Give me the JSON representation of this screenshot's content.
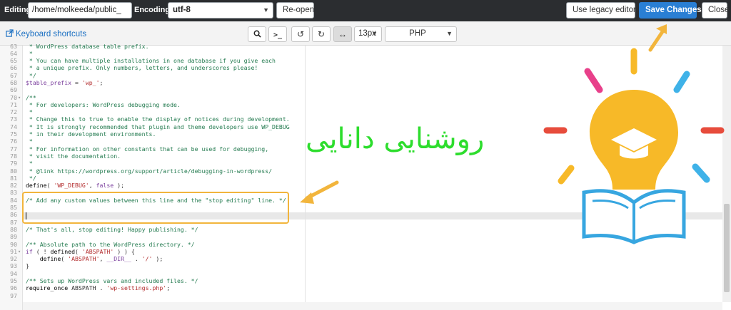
{
  "topbar": {
    "editing_label": "Editing:",
    "path_value": "/home/molkeeda/public_",
    "encoding_label": "Encoding:",
    "encoding_value": "utf-8",
    "reopen_label": "Re-open",
    "legacy_label": "Use legacy editor",
    "save_label": "Save Changes",
    "close_label": "Close"
  },
  "toolbar": {
    "shortcuts_label": "Keyboard shortcuts",
    "font_size": "13px",
    "mode": "PHP",
    "icons": [
      "search-icon",
      "terminal-icon",
      "undo-icon",
      "redo-icon",
      "wrap-icon"
    ]
  },
  "code": {
    "lines": [
      {
        "n": "63",
        "t": " * WordPress database table prefix.",
        "c": "comment",
        "fold": ""
      },
      {
        "n": "64",
        "t": " *",
        "c": "comment",
        "fold": ""
      },
      {
        "n": "65",
        "t": " * You can have multiple installations in one database if you give each",
        "c": "comment",
        "fold": ""
      },
      {
        "n": "66",
        "t": " * a unique prefix. Only numbers, letters, and underscores please!",
        "c": "comment",
        "fold": ""
      },
      {
        "n": "67",
        "t": " */",
        "c": "comment",
        "fold": ""
      },
      {
        "n": "68",
        "t": "",
        "c": "tableprefix",
        "fold": ""
      },
      {
        "n": "69",
        "t": "",
        "c": "plain",
        "fold": ""
      },
      {
        "n": "70",
        "t": "/**",
        "c": "comment",
        "fold": "▾"
      },
      {
        "n": "71",
        "t": " * For developers: WordPress debugging mode.",
        "c": "comment",
        "fold": ""
      },
      {
        "n": "72",
        "t": " *",
        "c": "comment",
        "fold": ""
      },
      {
        "n": "73",
        "t": " * Change this to true to enable the display of notices during development.",
        "c": "comment",
        "fold": ""
      },
      {
        "n": "74",
        "t": " * It is strongly recommended that plugin and theme developers use WP_DEBUG",
        "c": "comment",
        "fold": ""
      },
      {
        "n": "75",
        "t": " * in their development environments.",
        "c": "comment",
        "fold": ""
      },
      {
        "n": "76",
        "t": " *",
        "c": "comment",
        "fold": ""
      },
      {
        "n": "77",
        "t": " * For information on other constants that can be used for debugging,",
        "c": "comment",
        "fold": ""
      },
      {
        "n": "78",
        "t": " * visit the documentation.",
        "c": "comment",
        "fold": ""
      },
      {
        "n": "79",
        "t": " *",
        "c": "comment",
        "fold": ""
      },
      {
        "n": "80",
        "t": " * @link https://wordpress.org/support/article/debugging-in-wordpress/",
        "c": "comment",
        "fold": ""
      },
      {
        "n": "81",
        "t": " */",
        "c": "comment",
        "fold": ""
      },
      {
        "n": "82",
        "t": "",
        "c": "wpdebug",
        "fold": ""
      },
      {
        "n": "83",
        "t": "",
        "c": "plain",
        "fold": ""
      },
      {
        "n": "84",
        "t": "/* Add any custom values between this line and the \"stop editing\" line. */",
        "c": "comment",
        "fold": ""
      },
      {
        "n": "85",
        "t": "",
        "c": "plain",
        "fold": ""
      },
      {
        "n": "86",
        "t": "",
        "c": "plain",
        "fold": "",
        "active": true
      },
      {
        "n": "87",
        "t": "",
        "c": "plain",
        "fold": ""
      },
      {
        "n": "88",
        "t": "/* That's all, stop editing! Happy publishing. */",
        "c": "comment",
        "fold": ""
      },
      {
        "n": "89",
        "t": "",
        "c": "plain",
        "fold": ""
      },
      {
        "n": "90",
        "t": "/** Absolute path to the WordPress directory. */",
        "c": "comment",
        "fold": ""
      },
      {
        "n": "91",
        "t": "",
        "c": "ifabspath",
        "fold": "▾"
      },
      {
        "n": "92",
        "t": "",
        "c": "defineabspath",
        "fold": ""
      },
      {
        "n": "93",
        "t": "}",
        "c": "plain",
        "fold": ""
      },
      {
        "n": "94",
        "t": "",
        "c": "plain",
        "fold": ""
      },
      {
        "n": "95",
        "t": "/** Sets up WordPress vars and included files. */",
        "c": "comment",
        "fold": ""
      },
      {
        "n": "96",
        "t": "",
        "c": "require",
        "fold": ""
      },
      {
        "n": "97",
        "t": "",
        "c": "plain",
        "fold": ""
      }
    ]
  },
  "overlay": {
    "persian_text": "روشنایی دانایی",
    "colors": {
      "accent": "#f2b53c",
      "green": "#2ddd2d",
      "bulb": "#f7b928",
      "book": "#37a6e0"
    }
  }
}
